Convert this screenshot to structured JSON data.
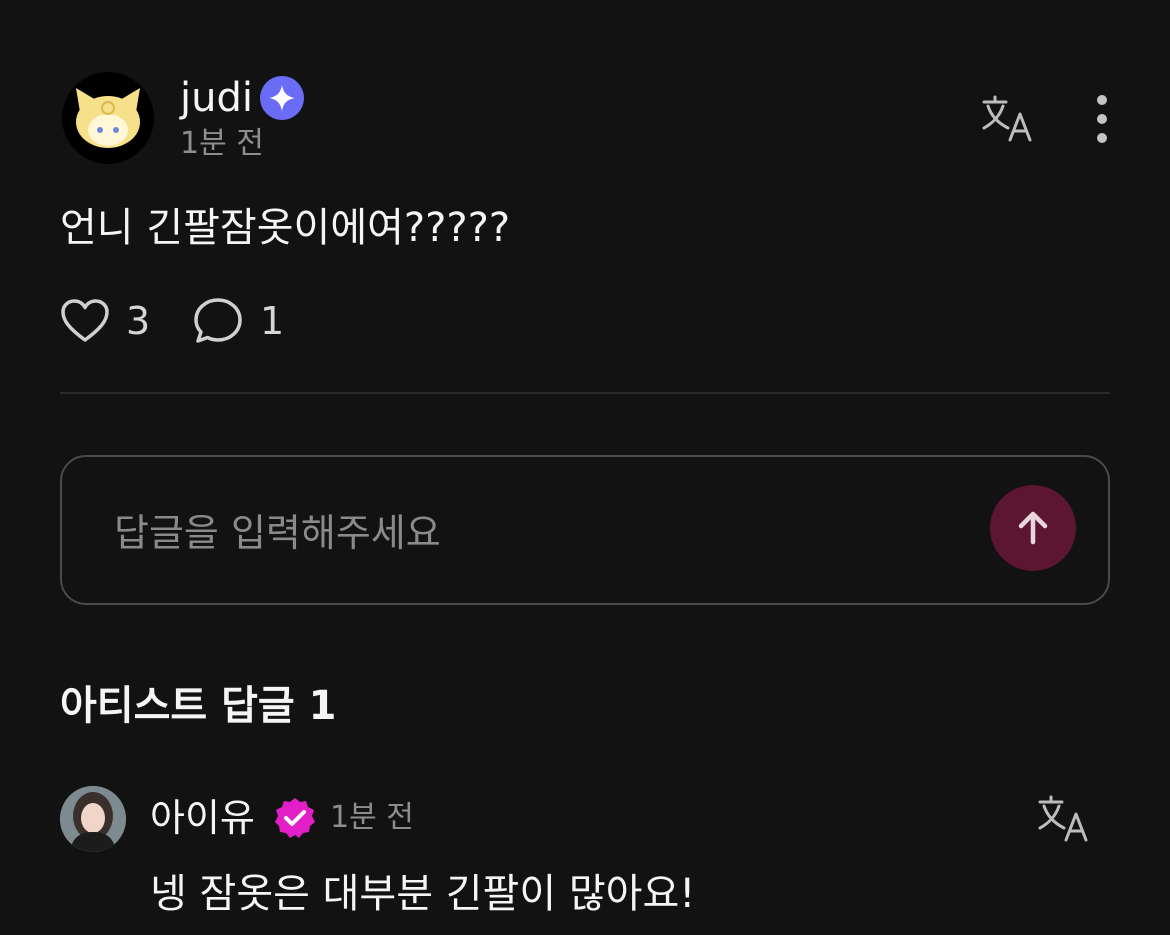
{
  "post": {
    "author": "judi",
    "time": "1분 전",
    "text": "언니 긴팔잠옷이에여?????",
    "likes": "3",
    "comments": "1"
  },
  "reply_input": {
    "placeholder": "답글을 입력해주세요"
  },
  "artist_section": {
    "title": "아티스트 답글 1",
    "reply": {
      "author": "아이유",
      "time": "1분 전",
      "text": "넹 잠옷은 대부분 긴팔이 많아요!"
    }
  },
  "icons": {
    "author_badge": "sparkle-badge-icon",
    "artist_badge": "verified-badge-icon",
    "translate": "translate-icon",
    "more": "more-vertical-icon",
    "like": "heart-icon",
    "comment": "comment-bubble-icon",
    "send": "arrow-up-icon"
  },
  "colors": {
    "background": "#121212",
    "author_badge": "#6b6cf6",
    "artist_badge": "#e21fc7",
    "send_button": "#5c1631"
  }
}
